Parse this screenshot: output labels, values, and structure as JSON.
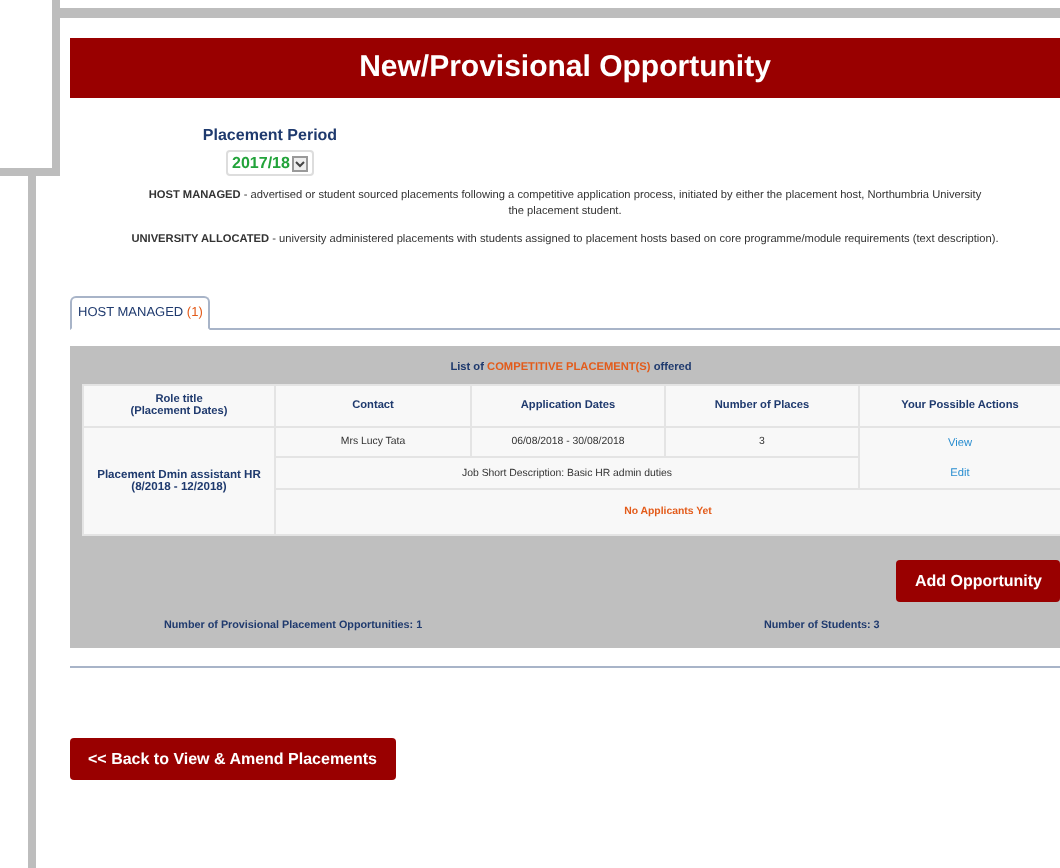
{
  "title": "New/Provisional Opportunity",
  "placement_period": {
    "label": "Placement Period",
    "value": "2017/18"
  },
  "descriptions": [
    {
      "term": "HOST MANAGED",
      "lines": [
        "- advertised or student sourced placements following a competitive application process, initiated by either the placement host, Northumbria University",
        "the placement student."
      ]
    },
    {
      "term": "UNIVERSITY ALLOCATED",
      "lines": [
        "- university administered placements with students assigned to placement hosts based on core programme/module requirements (text description)."
      ]
    }
  ],
  "tabs": [
    {
      "label": "HOST MANAGED",
      "count": "(1)",
      "selected": true
    }
  ],
  "list_caption": {
    "before": "List of",
    "highlight": "COMPETITIVE PLACEMENT(S)",
    "after": "offered"
  },
  "table": {
    "columns": [
      "Role title\n(Placement Dates)",
      "Contact",
      "Application Dates",
      "Number of Places",
      "Your Possible Actions"
    ],
    "rows": [
      {
        "role": "Placement Dmin assistant HR\n(8/2018 - 12/2018)",
        "contact": "Mrs Lucy Tata",
        "dates": "06/08/2018 - 30/08/2018",
        "places": "3",
        "actions": [
          "View",
          "Edit"
        ],
        "description": "Job Short Description: Basic HR admin duties",
        "applicants": "No Applicants Yet"
      }
    ]
  },
  "add_button": "Add Opportunity",
  "totals": [
    "Number of Provisional Placement Opportunities: 1",
    "Number of Students: 3"
  ],
  "back_button": "<< Back to View & Amend Placements"
}
